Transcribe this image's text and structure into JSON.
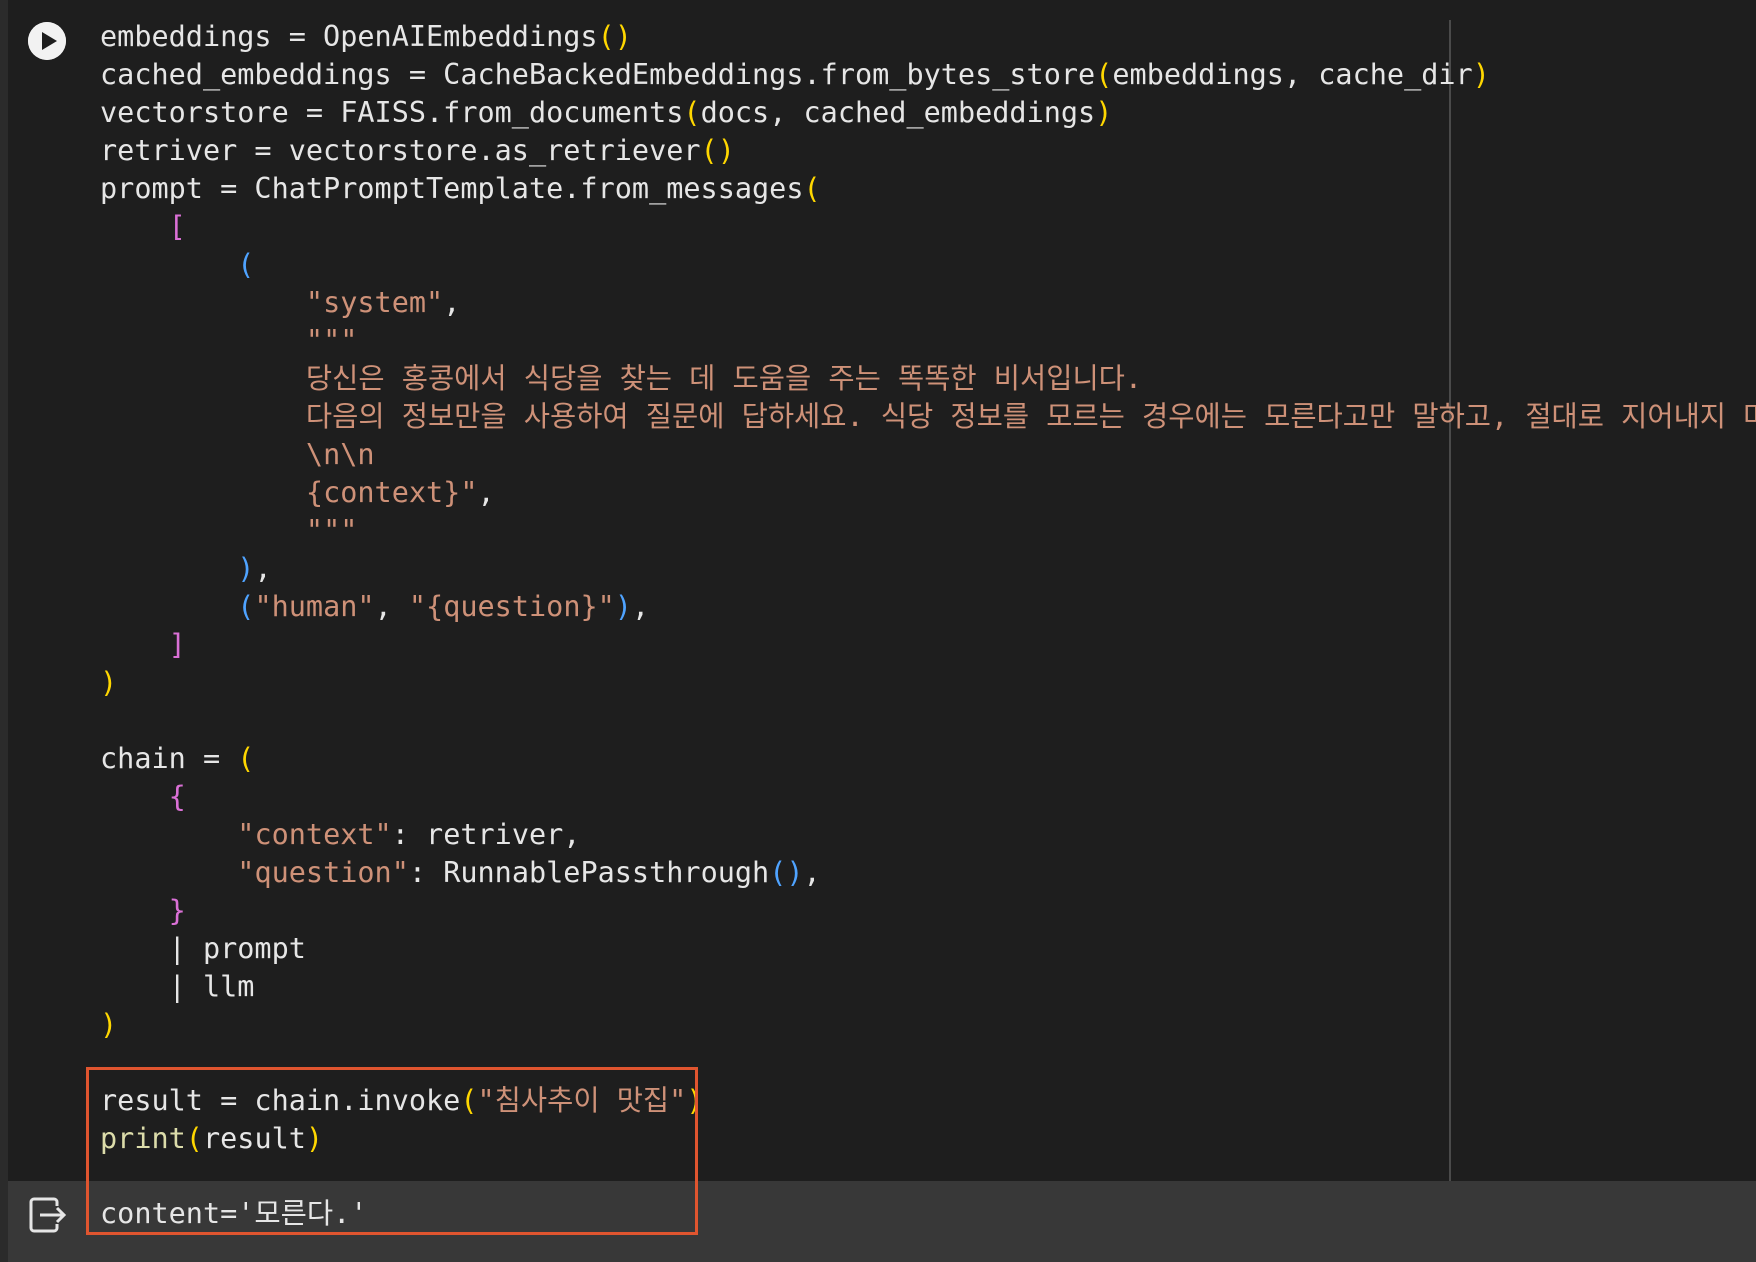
{
  "colors": {
    "background": "#1e1e1e",
    "output_background": "#383838",
    "highlight_border": "#e0552f",
    "string": "#ce9178",
    "bracket_yellow": "#ffd700",
    "bracket_purple": "#da70d6",
    "bracket_blue": "#4fa3ff",
    "text": "#e6e6e6"
  },
  "icons": {
    "run": "play-circle-icon",
    "output": "output-exit-icon"
  },
  "code_lines": [
    [
      [
        "t",
        "embeddings = OpenAIEmbeddings"
      ],
      [
        "y",
        "()"
      ]
    ],
    [
      [
        "t",
        "cached_embeddings = CacheBackedEmbeddings.from_bytes_store"
      ],
      [
        "y",
        "("
      ],
      [
        "t",
        "embeddings, cache_dir"
      ],
      [
        "y",
        ")"
      ]
    ],
    [
      [
        "t",
        "vectorstore = FAISS.from_documents"
      ],
      [
        "y",
        "("
      ],
      [
        "t",
        "docs, cached_embeddings"
      ],
      [
        "y",
        ")"
      ]
    ],
    [
      [
        "t",
        "retriver = vectorstore.as_retriever"
      ],
      [
        "y",
        "()"
      ]
    ],
    [
      [
        "t",
        "prompt = ChatPromptTemplate.from_messages"
      ],
      [
        "y",
        "("
      ]
    ],
    [
      [
        "t",
        "    "
      ],
      [
        "p",
        "["
      ]
    ],
    [
      [
        "t",
        "        "
      ],
      [
        "b",
        "("
      ]
    ],
    [
      [
        "t",
        "            "
      ],
      [
        "s",
        "\"system\""
      ],
      [
        "t",
        ","
      ]
    ],
    [
      [
        "t",
        "            "
      ],
      [
        "s",
        "\"\"\""
      ]
    ],
    [
      [
        "t",
        "            "
      ],
      [
        "s",
        "당신은 홍콩에서 식당을 찾는 데 도움을 주는 똑똑한 비서입니다."
      ]
    ],
    [
      [
        "t",
        "            "
      ],
      [
        "s",
        "다음의 정보만을 사용하여 질문에 답하세요. 식당 정보를 모르는 경우에는 모른다고만 말하고, 절대로 지어내지 마세요:"
      ]
    ],
    [
      [
        "t",
        "            "
      ],
      [
        "s",
        "\\n\\n"
      ]
    ],
    [
      [
        "t",
        "            "
      ],
      [
        "s",
        "{context}\""
      ],
      [
        "t",
        ","
      ]
    ],
    [
      [
        "t",
        "            "
      ],
      [
        "s",
        "\"\"\""
      ]
    ],
    [
      [
        "t",
        "        "
      ],
      [
        "b",
        ")"
      ],
      [
        "t",
        ","
      ]
    ],
    [
      [
        "t",
        "        "
      ],
      [
        "b",
        "("
      ],
      [
        "s",
        "\"human\""
      ],
      [
        "t",
        ", "
      ],
      [
        "s",
        "\"{question}\""
      ],
      [
        "b",
        ")"
      ],
      [
        "t",
        ","
      ]
    ],
    [
      [
        "t",
        "    "
      ],
      [
        "p",
        "]"
      ]
    ],
    [
      [
        "y",
        ")"
      ]
    ],
    [],
    [
      [
        "t",
        "chain = "
      ],
      [
        "y",
        "("
      ]
    ],
    [
      [
        "t",
        "    "
      ],
      [
        "p",
        "{"
      ]
    ],
    [
      [
        "t",
        "        "
      ],
      [
        "s",
        "\"context\""
      ],
      [
        "t",
        ": retriver,"
      ]
    ],
    [
      [
        "t",
        "        "
      ],
      [
        "s",
        "\"question\""
      ],
      [
        "t",
        ": RunnablePassthrough"
      ],
      [
        "b",
        "()"
      ],
      [
        "t",
        ","
      ]
    ],
    [
      [
        "t",
        "    "
      ],
      [
        "p",
        "}"
      ]
    ],
    [
      [
        "t",
        "    | prompt"
      ]
    ],
    [
      [
        "t",
        "    | llm"
      ]
    ],
    [
      [
        "y",
        ")"
      ]
    ],
    [],
    [
      [
        "t",
        "result = chain.invoke"
      ],
      [
        "y",
        "("
      ],
      [
        "s",
        "\"침사추이 맛집\""
      ],
      [
        "y",
        ")"
      ]
    ],
    [
      [
        "f",
        "print"
      ],
      [
        "y",
        "("
      ],
      [
        "t",
        "result"
      ],
      [
        "y",
        ")"
      ]
    ]
  ],
  "output": {
    "text": "content='모른다.'"
  }
}
